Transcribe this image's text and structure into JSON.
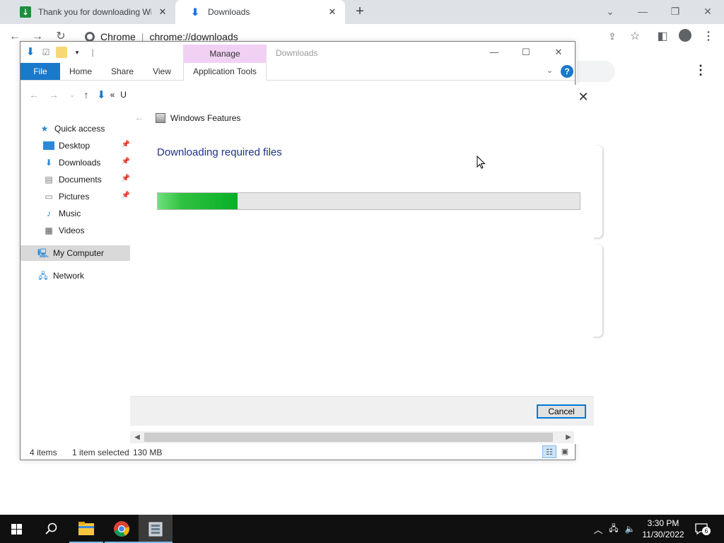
{
  "chrome": {
    "tabs": [
      {
        "title": "Thank you for downloading Wind",
        "icon": "sheet-favicon-icon"
      },
      {
        "title": "Downloads",
        "icon": "download-arrow-icon"
      }
    ],
    "omnibox_brand": "Chrome",
    "url": "chrome://downloads"
  },
  "explorer": {
    "ribbon_context_label": "Manage",
    "window_title": "Downloads",
    "ribbon_tabs": {
      "file": "File",
      "home": "Home",
      "share": "Share",
      "view": "View",
      "app_tools": "Application Tools"
    },
    "address_prefix": "«",
    "address_partial": "U",
    "nav": {
      "quick_access": "Quick access",
      "desktop": "Desktop",
      "downloads": "Downloads",
      "documents": "Documents",
      "pictures": "Pictures",
      "music": "Music",
      "videos": "Videos",
      "my_computer": "My Computer",
      "network": "Network"
    },
    "status": {
      "items": "4 items",
      "selected": "1 item selected",
      "size": "130 MB"
    }
  },
  "windows_features": {
    "title": "Windows Features",
    "heading": "Downloading required files",
    "progress_fraction": 0.19,
    "cancel_label": "Cancel"
  },
  "taskbar": {
    "time": "3:30 PM",
    "date": "11/30/2022",
    "notification_count": "6"
  },
  "colors": {
    "accent_blue": "#1979ca",
    "manage_tab": "#f1d1f3",
    "progress_green": "#06b025",
    "heading_blue": "#1e3287"
  }
}
